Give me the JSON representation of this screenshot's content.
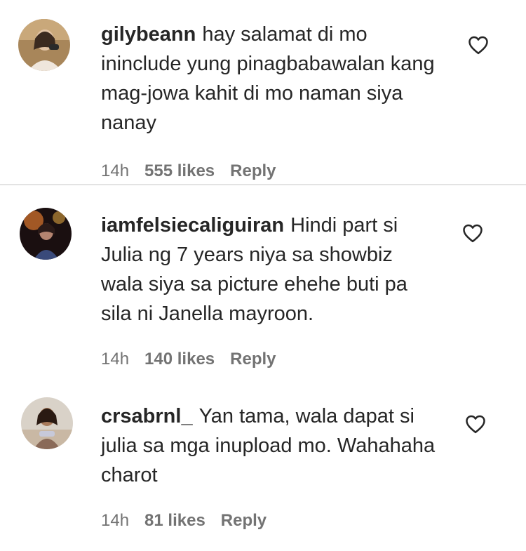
{
  "comments": [
    {
      "username": "gilybeann",
      "text": "hay salamat di mo ininclude yung pinagbabawalan kang mag-jowa kahit di mo naman siya nanay",
      "time": "14h",
      "likes": "555 likes",
      "reply": "Reply",
      "heart_icon": "heart-outline-icon"
    },
    {
      "username": "iamfelsiecaliguiran",
      "text": "Hindi part si Julia ng 7 years niya sa showbiz wala siya sa picture ehehe buti pa sila ni Janella mayroon.",
      "time": "14h",
      "likes": "140 likes",
      "reply": "Reply",
      "heart_icon": "heart-outline-icon"
    },
    {
      "username": "crsabrnl_",
      "text": "Yan tama, wala dapat si julia sa mga inupload mo. Wahahaha charot",
      "time": "14h",
      "likes": "81 likes",
      "reply": "Reply",
      "heart_icon": "heart-outline-icon"
    }
  ]
}
